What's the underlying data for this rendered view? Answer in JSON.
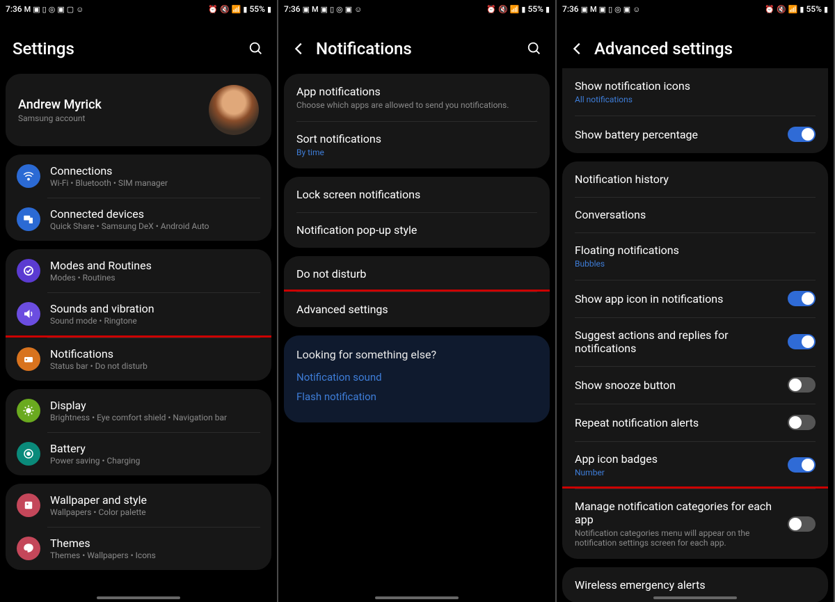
{
  "status": {
    "time": "7:36",
    "battery": "55%"
  },
  "screen1": {
    "title": "Settings",
    "profile": {
      "name": "Andrew Myrick",
      "sub": "Samsung account"
    },
    "groups": [
      {
        "rows": [
          {
            "icon": "wifi",
            "color": "#2b6ad4",
            "title": "Connections",
            "sub": "Wi-Fi  •  Bluetooth  •  SIM manager"
          },
          {
            "icon": "devices",
            "color": "#2b6ad4",
            "title": "Connected devices",
            "sub": "Quick Share  •  Samsung DeX  •  Android Auto"
          }
        ]
      },
      {
        "rows": [
          {
            "icon": "modes",
            "color": "#5b3bd1",
            "title": "Modes and Routines",
            "sub": "Modes  •  Routines"
          },
          {
            "icon": "sound",
            "color": "#6b4de0",
            "title": "Sounds and vibration",
            "sub": "Sound mode  •  Ringtone"
          },
          {
            "icon": "notif",
            "color": "#d8731e",
            "title": "Notifications",
            "sub": "Status bar  •  Do not disturb",
            "highlight": true
          }
        ]
      },
      {
        "rows": [
          {
            "icon": "display",
            "color": "#6aaa1f",
            "title": "Display",
            "sub": "Brightness  •  Eye comfort shield  •  Navigation bar"
          },
          {
            "icon": "battery",
            "color": "#0a8a7a",
            "title": "Battery",
            "sub": "Power saving  •  Charging"
          }
        ]
      },
      {
        "rows": [
          {
            "icon": "wallpaper",
            "color": "#c4475a",
            "title": "Wallpaper and style",
            "sub": "Wallpapers  •  Color palette"
          },
          {
            "icon": "themes",
            "color": "#c4475a",
            "title": "Themes",
            "sub": "Themes  •  Wallpapers  •  Icons"
          }
        ]
      }
    ]
  },
  "screen2": {
    "title": "Notifications",
    "groups": [
      {
        "rows": [
          {
            "title": "App notifications",
            "sub": "Choose which apps are allowed to send you notifications."
          },
          {
            "title": "Sort notifications",
            "sub": "By time",
            "subLink": true
          }
        ]
      },
      {
        "rows": [
          {
            "title": "Lock screen notifications"
          },
          {
            "title": "Notification pop-up style"
          }
        ]
      },
      {
        "rows": [
          {
            "title": "Do not disturb"
          },
          {
            "title": "Advanced settings",
            "highlight": true
          }
        ]
      }
    ],
    "help": {
      "title": "Looking for something else?",
      "links": [
        "Notification sound",
        "Flash notification"
      ]
    }
  },
  "screen3": {
    "title": "Advanced settings",
    "groups": [
      {
        "rows": [
          {
            "title": "Show notification icons",
            "sub": "All notifications",
            "subLink": true
          },
          {
            "title": "Show battery percentage",
            "toggle": true
          }
        ]
      },
      {
        "rows": [
          {
            "title": "Notification history"
          },
          {
            "title": "Conversations"
          },
          {
            "title": "Floating notifications",
            "sub": "Bubbles",
            "subLink": true
          },
          {
            "title": "Show app icon in notifications",
            "toggle": true
          },
          {
            "title": "Suggest actions and replies for notifications",
            "toggle": true
          },
          {
            "title": "Show snooze button",
            "toggle": false
          },
          {
            "title": "Repeat notification alerts",
            "toggle": false
          },
          {
            "title": "App icon badges",
            "sub": "Number",
            "subLink": true,
            "toggle": true
          },
          {
            "title": "Manage notification categories for each app",
            "sub": "Notification categories menu will appear on the notification settings screen for each app.",
            "toggle": false,
            "highlight": true
          }
        ]
      },
      {
        "rows": [
          {
            "title": "Wireless emergency alerts"
          }
        ]
      }
    ]
  }
}
